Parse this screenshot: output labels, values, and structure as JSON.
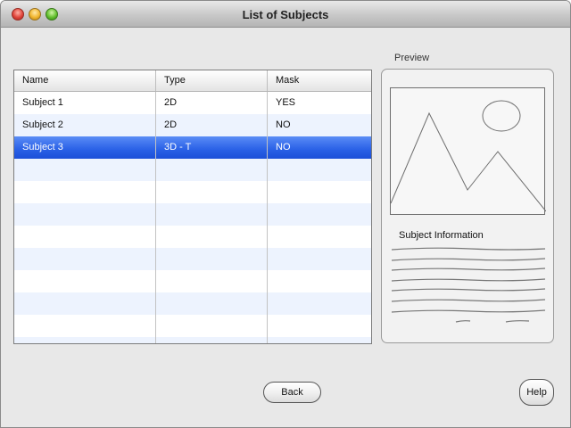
{
  "window": {
    "title": "List of Subjects"
  },
  "table": {
    "columns": [
      "Name",
      "Type",
      "Mask"
    ],
    "rows": [
      {
        "name": "Subject 1",
        "type": "2D",
        "mask": "YES"
      },
      {
        "name": "Subject 2",
        "type": "2D",
        "mask": "NO"
      },
      {
        "name": "Subject 3",
        "type": "3D - T",
        "mask": "NO"
      }
    ],
    "selected_row": 3,
    "selection_color": "#2960e6",
    "stripe_color": "#edf3fe"
  },
  "preview": {
    "label": "Preview",
    "image": "image-placeholder-icon",
    "info_heading": "Subject Information"
  },
  "buttons": {
    "back": "Back",
    "help": "Help"
  }
}
